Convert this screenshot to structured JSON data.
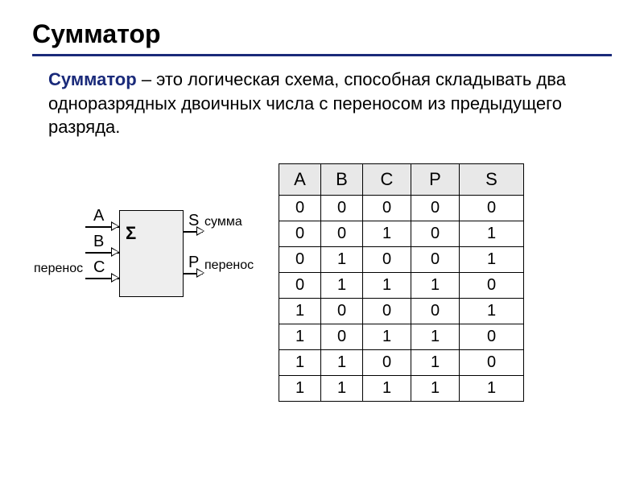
{
  "title": "Сумматор",
  "definition": {
    "term": "Сумматор",
    "rest": " – это логическая схема, способная складывать два одноразрядных двоичных числа с переносом из предыдущего разряда."
  },
  "diagram": {
    "symbol": "Σ",
    "inputs": {
      "a": "A",
      "b": "B",
      "c": "C"
    },
    "outputs": {
      "s": "S",
      "p": "P"
    },
    "input_carry_label": "перенос",
    "sum_label": "сумма",
    "output_carry_label": "перенос"
  },
  "table": {
    "headers": [
      "A",
      "B",
      "C",
      "P",
      "S"
    ],
    "rows": [
      [
        0,
        0,
        0,
        0,
        0
      ],
      [
        0,
        0,
        1,
        0,
        1
      ],
      [
        0,
        1,
        0,
        0,
        1
      ],
      [
        0,
        1,
        1,
        1,
        0
      ],
      [
        1,
        0,
        0,
        0,
        1
      ],
      [
        1,
        0,
        1,
        1,
        0
      ],
      [
        1,
        1,
        0,
        1,
        0
      ],
      [
        1,
        1,
        1,
        1,
        1
      ]
    ]
  }
}
